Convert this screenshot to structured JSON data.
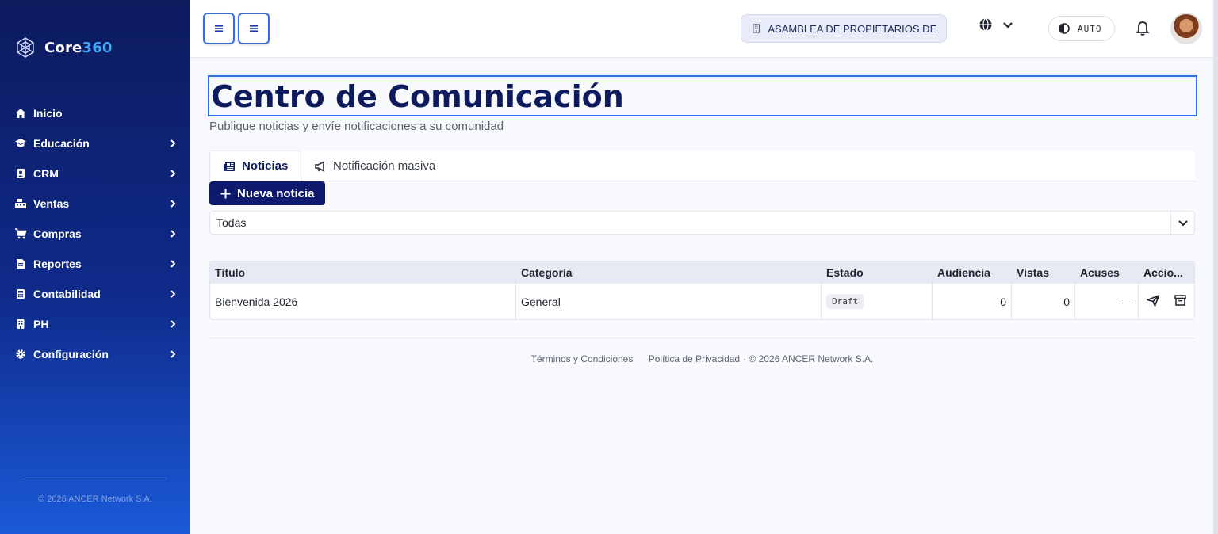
{
  "brand": {
    "name_part1": "Core",
    "name_part2": "360"
  },
  "sidebar": {
    "items": [
      {
        "label": "Inicio",
        "icon": "home-icon",
        "has_children": false
      },
      {
        "label": "Educación",
        "icon": "graduation-cap-icon",
        "has_children": true
      },
      {
        "label": "CRM",
        "icon": "address-book-icon",
        "has_children": true
      },
      {
        "label": "Ventas",
        "icon": "cash-register-icon",
        "has_children": true
      },
      {
        "label": "Compras",
        "icon": "cart-icon",
        "has_children": true
      },
      {
        "label": "Reportes",
        "icon": "file-report-icon",
        "has_children": true
      },
      {
        "label": "Contabilidad",
        "icon": "calculator-icon",
        "has_children": true
      },
      {
        "label": "PH",
        "icon": "building-icon",
        "has_children": true
      },
      {
        "label": "Configuración",
        "icon": "gear-icon",
        "has_children": true
      }
    ],
    "footer": "© 2026 ANCER Network S.A."
  },
  "topbar": {
    "organization": "ASAMBLEA DE PROPIETARIOS DE ...",
    "theme_label": "AUTO"
  },
  "page": {
    "title": "Centro de Comunicación",
    "subtitle": "Publique noticias y envíe notificaciones a su comunidad"
  },
  "tabs": [
    {
      "label": "Noticias",
      "active": true
    },
    {
      "label": "Notificación masiva",
      "active": false
    }
  ],
  "new_button": "Nueva noticia",
  "filter": {
    "selected": "Todas"
  },
  "table": {
    "columns": [
      "Título",
      "Categoría",
      "Estado",
      "Audiencia",
      "Vistas",
      "Acuses",
      "Accio..."
    ],
    "rows": [
      {
        "title": "Bienvenida 2026",
        "category": "General",
        "status": "Draft",
        "audience": "0",
        "views": "0",
        "acks": "—"
      }
    ]
  },
  "footer": {
    "terms": "Términos y Condiciones",
    "privacy": "Política de Privacidad",
    "copyright": "· © 2026 ANCER Network S.A."
  },
  "colors": {
    "sidebar_top": "#0d1b5e",
    "sidebar_bottom": "#1a5ad8",
    "accent": "#2b6ee8",
    "primary_button": "#0e1a6e",
    "title": "#0e1a5e"
  }
}
